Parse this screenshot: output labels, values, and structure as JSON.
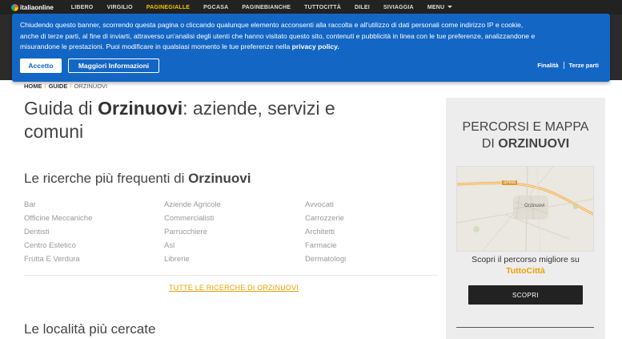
{
  "topnav": {
    "logo": "italiaonline",
    "links": [
      "LIBERO",
      "VIRGILIO",
      "PAGINEGIALLE",
      "PGCASA",
      "PAGINEBIANCHE",
      "TUTTOCITTÀ",
      "DILEI",
      "SIVIAGGIA",
      "MENU"
    ],
    "active": "PAGINEGIALLE"
  },
  "cookie": {
    "line1": "Chiudendo questo banner, scorrendo questa pagina o cliccando qualunque elemento acconsenti alla raccolta e all'utilizzo di dati personali come indirizzo IP e cookie,",
    "line2": "anche di terze parti, al fine di inviarti, attraverso un'analisi degli utenti che hanno visitato questo sito, contenuti e pubblicità in linea con le tue preferenze, analizzandone e",
    "line3a": "misurandone le prestazioni. Puoi modificare in qualsiasi momento le tue preferenze nella ",
    "privacy": "privacy policy.",
    "accept": "Accetto",
    "more": "Maggiori Informazioni",
    "finalita": "Finalità",
    "terze": "Terze parti"
  },
  "breadcrumb": {
    "home": "HOME",
    "guide": "GUIDE",
    "current": "ORZINUOVI"
  },
  "title": {
    "pre": "Guida di ",
    "city": "Orzinuovi",
    "post": ": aziende, servizi e comuni"
  },
  "searches": {
    "pre": "Le ricerche più frequenti di ",
    "city": "Orzinuovi",
    "col1": [
      "Bar",
      "Officine Meccaniche",
      "Dentisti",
      "Centro Estetico",
      "Frutta E Verdura"
    ],
    "col2": [
      "Aziende Agricole",
      "Commercialisti",
      "Parrucchiere",
      "Asl",
      "Librerie"
    ],
    "col3": [
      "Avvocati",
      "Carrozzerie",
      "Architetti",
      "Farmacie",
      "Dermatologi"
    ],
    "all_link": "TUTTE LE RICERCHE DI ORZINUOVI"
  },
  "localita": {
    "title": "Le località più cercate"
  },
  "rightbox": {
    "title1": "PERCORSI E MAPPA",
    "title2pre": "DI ",
    "city": "ORZINUOVI",
    "map_label": "Orzinuovi",
    "map_road": "SP668",
    "desc": "Scopri il percorso migliore su",
    "brand": "TuttoCittà",
    "button": "SCOPRI"
  },
  "colors": {
    "accent": "#f0a000",
    "banner": "#1466c5",
    "nav": "#222222"
  }
}
